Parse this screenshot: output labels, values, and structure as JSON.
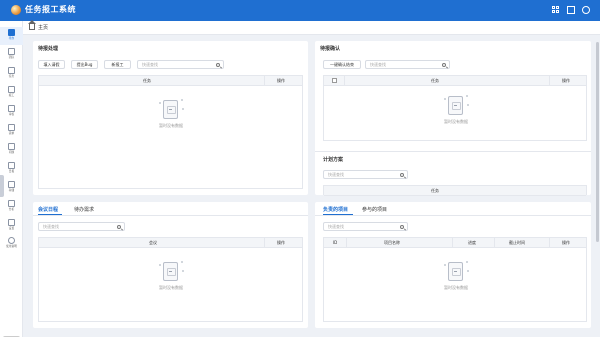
{
  "app": {
    "title": "任务报工系统"
  },
  "header_icons": {
    "apps": "grid-icon",
    "fullscreen": "fullscreen-icon",
    "settings": "gear-icon"
  },
  "sidebar": {
    "items": [
      {
        "label": "待办",
        "icon": "home-icon",
        "active": true
      },
      {
        "label": "团队",
        "icon": "team-icon"
      },
      {
        "label": "任务",
        "icon": "task-icon"
      },
      {
        "label": "报工",
        "icon": "report-icon"
      },
      {
        "label": "审核",
        "icon": "review-icon"
      },
      {
        "label": "需求",
        "icon": "requirement-icon"
      },
      {
        "label": "问题",
        "icon": "issue-icon"
      },
      {
        "label": "日报",
        "icon": "daily-icon"
      },
      {
        "label": "存储",
        "icon": "storage-icon"
      },
      {
        "label": "分析",
        "icon": "analysis-icon"
      },
      {
        "label": "设置",
        "icon": "settings-icon"
      },
      {
        "label": "使用说明",
        "icon": "help-icon"
      }
    ],
    "lang": "CN"
  },
  "breadcrumb": {
    "home": "主页"
  },
  "todo_panel": {
    "title": "待报处理",
    "buttons": [
      "填入请假",
      "提出Bug",
      "新报工"
    ],
    "search_placeholder": "快速查找",
    "columns": [
      "任务",
      "操作"
    ],
    "empty_text": "暂时没有数据"
  },
  "confirm_panel": {
    "title": "待报确认",
    "button": "一键确认结束",
    "search_placeholder": "快速查找",
    "columns": [
      "任务",
      "操作"
    ],
    "empty_text": "暂时没有数据"
  },
  "plan_panel": {
    "title": "计划方案",
    "search_placeholder": "快速查找",
    "columns": [
      "任务"
    ]
  },
  "meeting_panel": {
    "tabs": [
      "会议日程",
      "待办需求"
    ],
    "search_placeholder": "快速查找",
    "columns": [
      "会议",
      "操作"
    ],
    "empty_text": "暂时没有数据"
  },
  "project_panel": {
    "tabs": [
      "负责的项目",
      "参与的项目"
    ],
    "search_placeholder": "快速查找",
    "columns": [
      "ID",
      "项目名称",
      "进度",
      "截止时间",
      "操作"
    ],
    "empty_text": "暂时没有数据"
  },
  "colors": {
    "primary": "#1f6fd1",
    "background": "#eef1f6"
  }
}
